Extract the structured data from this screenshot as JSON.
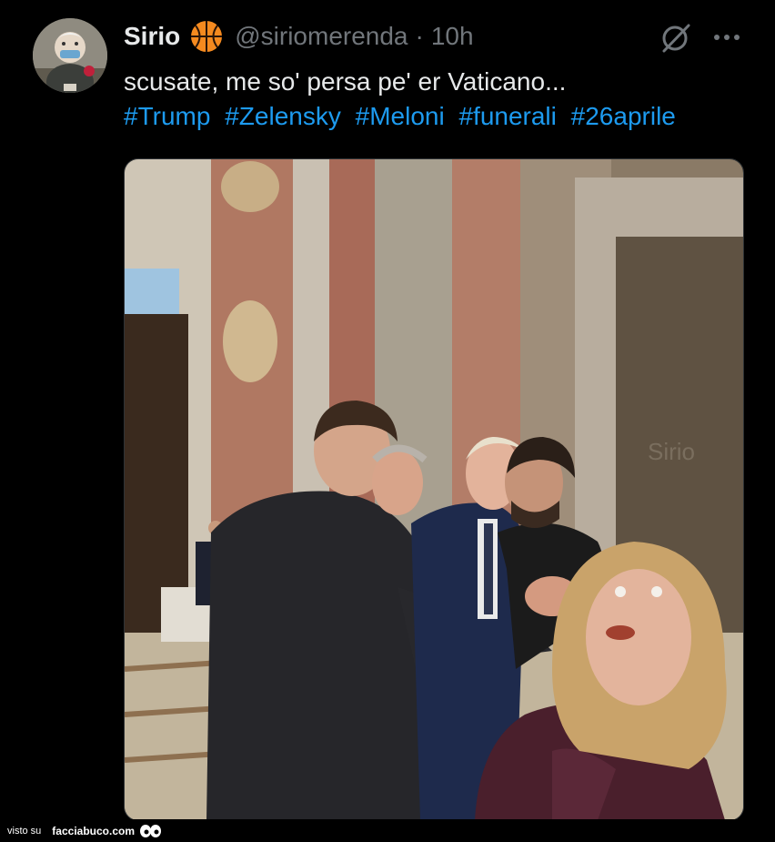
{
  "tweet": {
    "author_name": "Sirio",
    "handle": "@siriomerenda",
    "separator": "·",
    "time": "10h",
    "text": "scusate, me so' persa pe' er Vaticano...",
    "hashtags": [
      "#Trump",
      "#Zelensky",
      "#Meloni",
      "#funerali",
      "#26aprile"
    ],
    "badge_icon": "basketball-icon",
    "grok_icon": "grok-icon",
    "more_icon": "more-icon",
    "accent_color": "#1d9bf0",
    "media_watermark": "Sirio"
  },
  "footer": {
    "visto_label": "visto su",
    "brand": "facciabuco.com"
  }
}
